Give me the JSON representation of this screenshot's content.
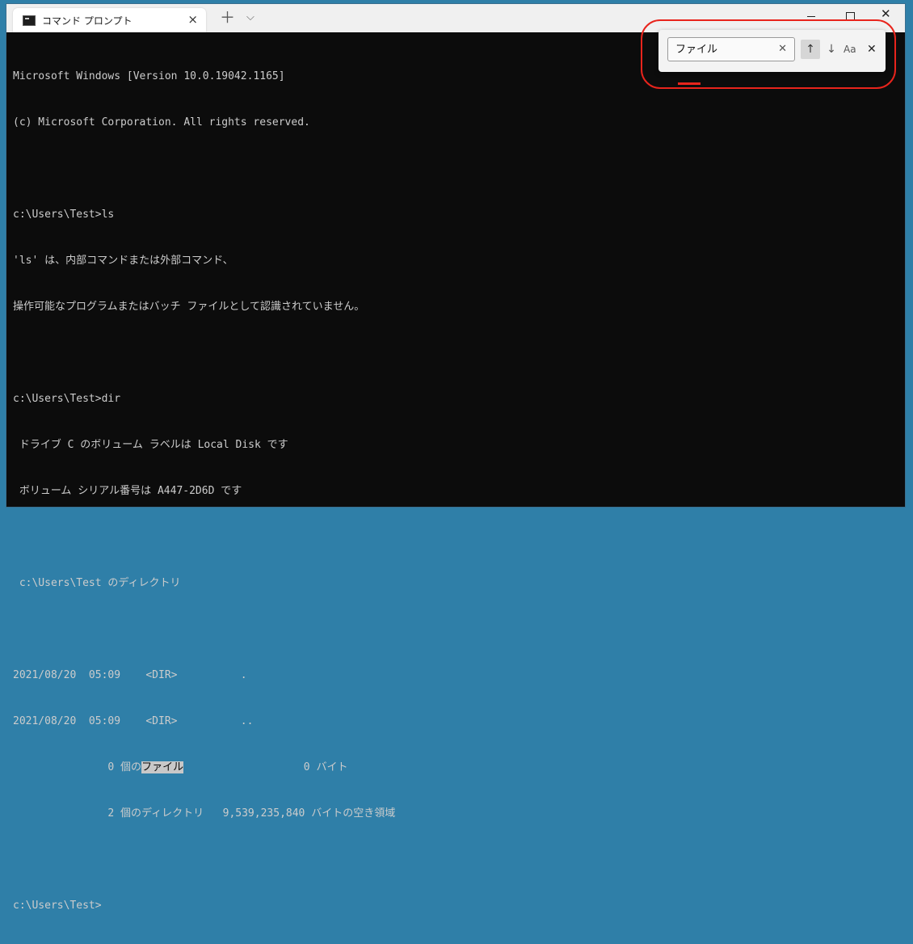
{
  "tab": {
    "title": "コマンド プロンプト",
    "close_icon": "×"
  },
  "tabbar": {
    "new_tab_icon": "＋",
    "dropdown_icon": "⌵"
  },
  "window_controls": {
    "close_icon": "✕"
  },
  "terminal": {
    "lines": [
      "Microsoft Windows [Version 10.0.19042.1165]",
      "(c) Microsoft Corporation. All rights reserved.",
      "",
      "c:\\Users\\Test>ls",
      "'ls' は、内部コマンドまたは外部コマンド、",
      "操作可能なプログラムまたはバッチ ファイルとして認識されていません。",
      "",
      "c:\\Users\\Test>dir",
      " ドライブ C のボリューム ラベルは Local Disk です",
      " ボリューム シリアル番号は A447-2D6D です",
      "",
      " c:\\Users\\Test のディレクトリ",
      "",
      "2021/08/20  05:09    <DIR>          .",
      "2021/08/20  05:09    <DIR>          ..",
      "",
      "               2 個のディレクトリ   9,539,235,840 バイトの空き領域",
      "",
      "c:\\Users\\Test>"
    ],
    "files_line": {
      "prefix": "               0 個の",
      "match": "ファイル",
      "suffix": "                   0 バイト"
    }
  },
  "find": {
    "query": "ファイル",
    "clear_icon": "✕",
    "prev_icon": "↑",
    "next_icon": "↓",
    "case_label": "Aa",
    "close_icon": "✕"
  },
  "colors": {
    "terminal_bg": "#0c0c0c",
    "terminal_fg": "#cccccc",
    "highlight": "#c8c8c8",
    "annotation": "#e8241c"
  }
}
